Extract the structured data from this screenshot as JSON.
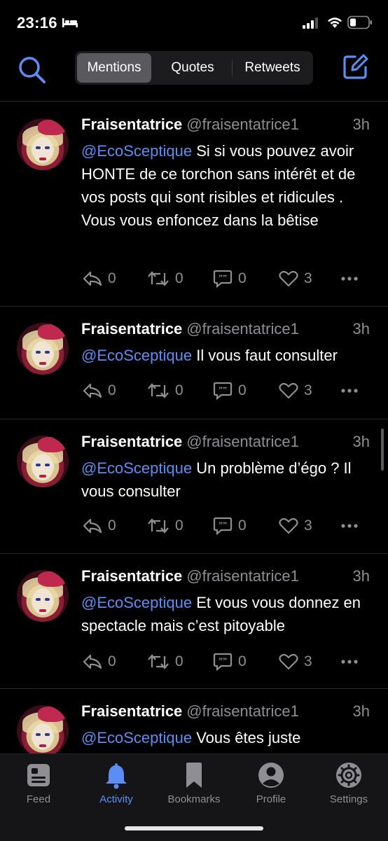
{
  "status_bar": {
    "time": "23:16",
    "colors": {
      "text": "#ffffff"
    }
  },
  "segmented": {
    "tabs": [
      {
        "label": "Mentions",
        "active": true
      },
      {
        "label": "Quotes",
        "active": false
      },
      {
        "label": "Retweets",
        "active": false
      }
    ]
  },
  "tweets": [
    {
      "name": "Fraisentatrice",
      "handle": "@fraisentatrice1",
      "time": "3h",
      "mention": "@EcoSceptique",
      "text": " Si si vous pouvez avoir HONTE de ce torchon sans intérêt et de vos posts qui sont risibles  et ridicules . Vous vous enfoncez dans la bêtise",
      "replies": "0",
      "retweets": "0",
      "quotes": "0",
      "likes": "3"
    },
    {
      "name": "Fraisentatrice",
      "handle": "@fraisentatrice1",
      "time": "3h",
      "mention": "@EcoSceptique",
      "text": " Il vous faut consulter",
      "replies": "0",
      "retweets": "0",
      "quotes": "0",
      "likes": "3"
    },
    {
      "name": "Fraisentatrice",
      "handle": "@fraisentatrice1",
      "time": "3h",
      "mention": "@EcoSceptique",
      "text": " Un problème d’égo ? Il vous consulter",
      "replies": "0",
      "retweets": "0",
      "quotes": "0",
      "likes": "3"
    },
    {
      "name": "Fraisentatrice",
      "handle": "@fraisentatrice1",
      "time": "3h",
      "mention": "@EcoSceptique",
      "text": " Et vous vous donnez en spectacle mais c’est pitoyable",
      "replies": "0",
      "retweets": "0",
      "quotes": "0",
      "likes": "3"
    },
    {
      "name": "Fraisentatrice",
      "handle": "@fraisentatrice1",
      "time": "3h",
      "mention": "@EcoSceptique",
      "text": " Vous êtes juste",
      "replies": "",
      "retweets": "",
      "quotes": "",
      "likes": ""
    }
  ],
  "tabbar": {
    "items": [
      {
        "label": "Feed",
        "icon": "feed-icon",
        "active": false
      },
      {
        "label": "Activity",
        "icon": "bell-icon",
        "active": true
      },
      {
        "label": "Bookmarks",
        "icon": "bookmark-icon",
        "active": false
      },
      {
        "label": "Profile",
        "icon": "profile-icon",
        "active": false
      },
      {
        "label": "Settings",
        "icon": "gear-icon",
        "active": false
      }
    ]
  },
  "colors": {
    "accent": "#5b8ef5",
    "background": "#000000",
    "secondary_text": "#8e8e93",
    "segment_active": "#5a5a5e"
  }
}
